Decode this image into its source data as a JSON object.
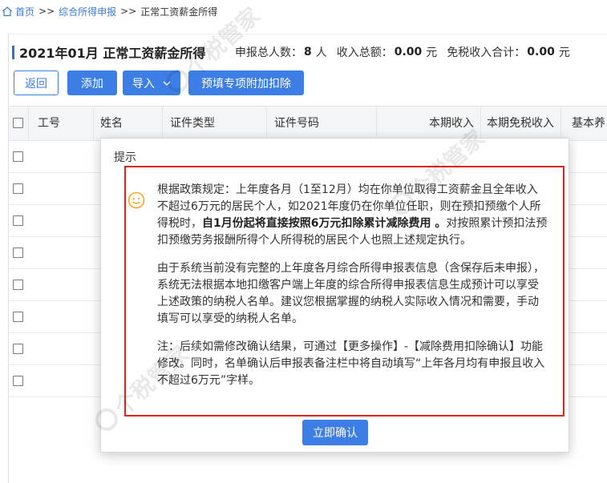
{
  "breadcrumb": {
    "items": [
      {
        "label": "首页"
      },
      {
        "label": "综合所得申报"
      },
      {
        "label": "正常工资薪金所得"
      }
    ],
    "separator": ">>"
  },
  "header": {
    "title": "2021年01月 正常工资薪金所得",
    "stats": [
      {
        "label": "申报总人数：",
        "value": "8",
        "unit": "人"
      },
      {
        "label": "收入总额：",
        "value": "0.00",
        "unit": "元"
      },
      {
        "label": "免税收入合计：",
        "value": "0.00",
        "unit": "元"
      }
    ]
  },
  "toolbar": {
    "back_label": "返回",
    "add_label": "添加",
    "import_label": "导入",
    "prefill_label": "预填专项附加扣除"
  },
  "table": {
    "columns": [
      "工号",
      "姓名",
      "证件类型",
      "证件号码",
      "本期收入",
      "本期免税收入",
      "基本养"
    ]
  },
  "dialog": {
    "title": "提示",
    "paragraph_1": [
      "根据政策规定：上年度各月（1至12月）均在你单位取得工资薪金且全年收入",
      "不超过6万元的居民个人，如2021年度仍在你单位任职，则在预扣预缴个人所",
      {
        "start": "得税时，",
        "emphasis": "自1月份起将直接按照6万元扣除累计减除费用 。",
        "end": "对按照累计预扣法预"
      },
      "扣预缴劳务报酬所得个人所得税的居民个人也照上述规定执行。"
    ],
    "paragraph_2": [
      "由于系统当前没有完整的上年度各月综合所得申报表信息（含保存后未申报），",
      "系统无法根据本地扣缴客户端上年度的综合所得申报表信息生成预计可以享受",
      "上述政策的纳税人名单。建议您根据掌握的纳税人实际收入情况和需要，手动",
      "填写可以享受的纳税人名单。"
    ],
    "paragraph_3": [
      "注：后续如需修改确认结果，可通过【更多操作】-【减除费用扣除确认】功能",
      "修改。同时，名单确认后申报表备注栏中将自动填写“上年各月均有申报且收入",
      "不超过6万元”字样。"
    ],
    "confirm_label": "立即确认"
  },
  "watermark": {
    "text": "个税管家"
  },
  "icons": {
    "home": "home-icon",
    "import_menu": "chevron-down-icon",
    "dialog_status": "smiley-icon",
    "watermark_logo": "watermark-logo-icon"
  },
  "colors": {
    "accent": "#3d7ee6",
    "link": "#3a7bd5",
    "title_bar": "#2f6fd6",
    "highlight_border": "#e3231c",
    "smiley": "#f5a623"
  }
}
